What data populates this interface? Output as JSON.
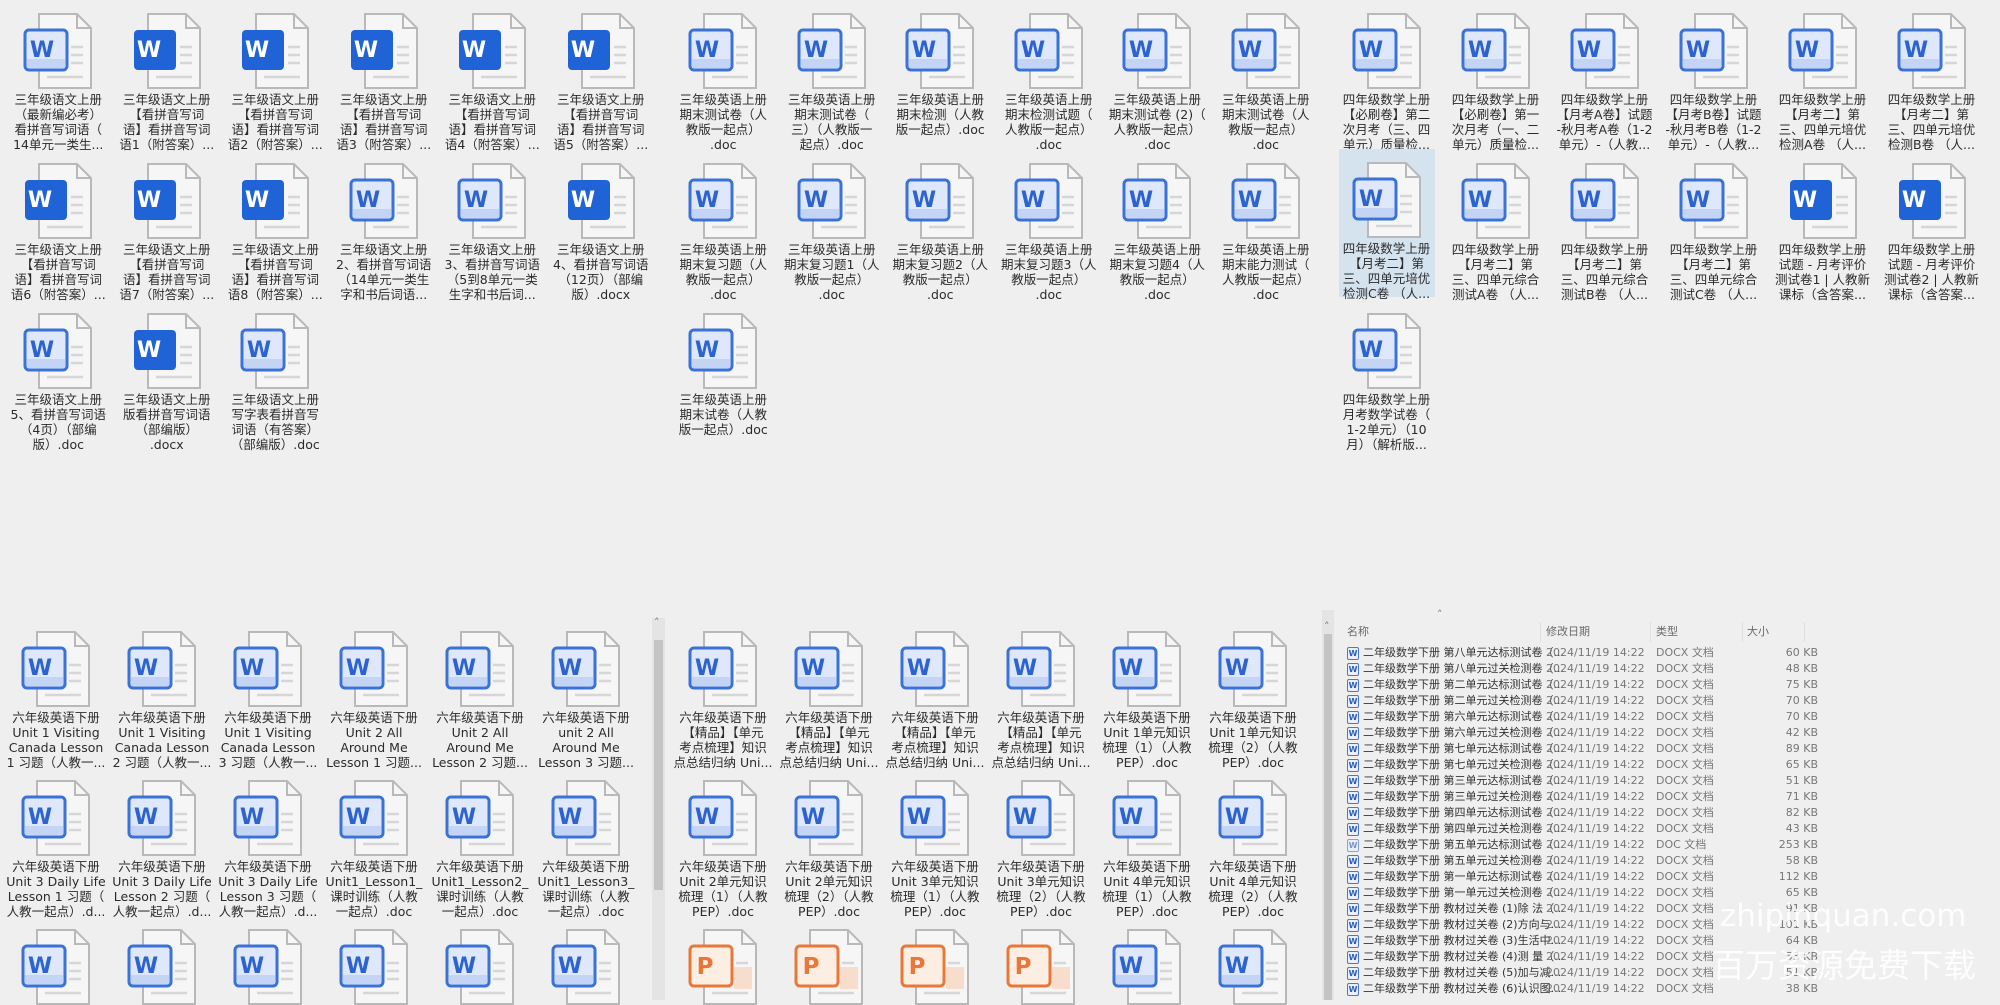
{
  "colors": {
    "word_dark": "#1f63d6",
    "word_light_border": "#3a72d8",
    "word_light_fill": "#dfe8fa",
    "ppt": "#e8783a",
    "selected_bg": "#d5e3ef",
    "background": "#efefef"
  },
  "panels": [
    {
      "name": "grade3-chinese-panel",
      "items": [
        {
          "icon": "word-light",
          "label": "三年级语文上册\n（最新编必考）\n看拼音写词语（\n14单元一类生..."
        },
        {
          "icon": "word-dark",
          "label": "三年级语文上册\n【看拼音写词\n语】看拼音写词\n语1（附答案）..."
        },
        {
          "icon": "word-dark",
          "label": "三年级语文上册\n【看拼音写词\n语】看拼音写词\n语2（附答案）..."
        },
        {
          "icon": "word-dark",
          "label": "三年级语文上册\n【看拼音写词\n语】看拼音写词\n语3（附答案）..."
        },
        {
          "icon": "word-dark",
          "label": "三年级语文上册\n【看拼音写词\n语】看拼音写词\n语4（附答案）..."
        },
        {
          "icon": "word-dark",
          "label": "三年级语文上册\n【看拼音写词\n语】看拼音写词\n语5（附答案）..."
        },
        {
          "icon": "word-dark",
          "label": "三年级语文上册\n【看拼音写词\n语】看拼音写词\n语6（附答案）..."
        },
        {
          "icon": "word-dark",
          "label": "三年级语文上册\n【看拼音写词\n语】看拼音写词\n语7（附答案）..."
        },
        {
          "icon": "word-dark",
          "label": "三年级语文上册\n【看拼音写词\n语】看拼音写词\n语8（附答案）..."
        },
        {
          "icon": "word-light",
          "label": "三年级语文上册\n2、看拼音写词语\n（14单元一类生\n字和书后词语..."
        },
        {
          "icon": "word-light",
          "label": "三年级语文上册\n3、看拼音写词语\n（5到8单元一类\n生字和书后词..."
        },
        {
          "icon": "word-dark",
          "label": "三年级语文上册\n4、看拼音写词语\n（12页）（部编\n版）.docx"
        },
        {
          "icon": "word-light",
          "label": "三年级语文上册\n5、看拼音写词语\n（4页）（部编\n版）.doc"
        },
        {
          "icon": "word-dark",
          "label": "三年级语文上册\n版看拼音写词语\n（部编版）\n.docx"
        },
        {
          "icon": "word-light",
          "label": "三年级语文上册\n写字表看拼音写\n词语（有答案）\n（部编版）.doc"
        }
      ]
    },
    {
      "name": "grade3-english-panel",
      "items": [
        {
          "icon": "word-light",
          "label": "三年级英语上册\n期末测试卷（人\n教版一起点）\n.doc"
        },
        {
          "icon": "word-light",
          "label": "三年级英语上册\n期末测试卷（\n三）（人教版一\n起点）.doc"
        },
        {
          "icon": "word-light",
          "label": "三年级英语上册\n期末检测（人教\n版一起点）.doc"
        },
        {
          "icon": "word-light",
          "label": "三年级英语上册\n期末检测试题（\n人教版一起点）\n.doc"
        },
        {
          "icon": "word-light",
          "label": "三年级英语上册\n期末测试卷 (2)（\n人教版一起点）\n.doc"
        },
        {
          "icon": "word-light",
          "label": "三年级英语上册\n期末测试卷（人\n教版一起点）\n.doc"
        },
        {
          "icon": "word-light",
          "label": "三年级英语上册\n期末复习题（人\n教版一起点）\n.doc"
        },
        {
          "icon": "word-light",
          "label": "三年级英语上册\n期末复习题1（人\n教版一起点）\n.doc"
        },
        {
          "icon": "word-light",
          "label": "三年级英语上册\n期末复习题2（人\n教版一起点）\n.doc"
        },
        {
          "icon": "word-light",
          "label": "三年级英语上册\n期末复习题3（人\n教版一起点）\n.doc"
        },
        {
          "icon": "word-light",
          "label": "三年级英语上册\n期末复习题4（人\n教版一起点）\n.doc"
        },
        {
          "icon": "word-light",
          "label": "三年级英语上册\n期末能力测试（\n人教版一起点）\n.doc"
        },
        {
          "icon": "word-light",
          "label": "三年级英语上册\n期末试卷（人教\n版一起点）.doc"
        }
      ]
    },
    {
      "name": "grade4-math-panel",
      "items": [
        {
          "icon": "word-light",
          "label": "四年级数学上册\n【必刷卷】第二\n次月考（三、四\n单元）质量检..."
        },
        {
          "icon": "word-light",
          "label": "四年级数学上册\n【必刷卷】第一\n次月考（一、二\n单元）质量检..."
        },
        {
          "icon": "word-light",
          "label": "四年级数学上册\n【月考A卷】试题\n-秋月考A卷（1-2\n单元）-（人教..."
        },
        {
          "icon": "word-light",
          "label": "四年级数学上册\n【月考B卷】试题\n-秋月考B卷（1-2\n单元）-（人教..."
        },
        {
          "icon": "word-light",
          "label": "四年级数学上册\n【月考二】第\n三、四单元培优\n检测A卷 （人..."
        },
        {
          "icon": "word-light",
          "label": "四年级数学上册\n【月考二】第\n三、四单元培优\n检测B卷 （人..."
        },
        {
          "icon": "word-light",
          "selected": true,
          "label": "四年级数学上册\n【月考二】第\n三、四单元培优\n检测C卷 （人..."
        },
        {
          "icon": "word-light",
          "label": "四年级数学上册\n【月考二】第\n三、四单元综合\n测试A卷 （人..."
        },
        {
          "icon": "word-light",
          "label": "四年级数学上册\n【月考二】第\n三、四单元综合\n测试B卷 （人..."
        },
        {
          "icon": "word-light",
          "label": "四年级数学上册\n【月考二】第\n三、四单元综合\n测试C卷 （人..."
        },
        {
          "icon": "word-dark",
          "label": "四年级数学上册\n试题 - 月考评价\n测试卷1 | 人教新\n课标（含答案..."
        },
        {
          "icon": "word-dark",
          "label": "四年级数学上册\n试题 - 月考评价\n测试卷2 | 人教新\n课标（含答案..."
        },
        {
          "icon": "word-light",
          "label": "四年级数学上册\n月考数学试卷（\n1-2单元）（10\n月）（解析版..."
        }
      ]
    },
    {
      "name": "grade6-english-panel-a",
      "items": [
        {
          "icon": "word-light",
          "label": "六年级英语下册\nUnit 1 Visiting\nCanada Lesson\n1 习题（人教一..."
        },
        {
          "icon": "word-light",
          "label": "六年级英语下册\nUnit 1 Visiting\nCanada Lesson\n2 习题（人教一..."
        },
        {
          "icon": "word-light",
          "label": "六年级英语下册\nUnit 1 Visiting\nCanada Lesson\n3 习题（人教一..."
        },
        {
          "icon": "word-light",
          "label": "六年级英语下册\nUnit 2 All\nAround Me\nLesson 1 习题..."
        },
        {
          "icon": "word-light",
          "label": "六年级英语下册\nUnit 2 All\nAround Me\nLesson 2 习题..."
        },
        {
          "icon": "word-light",
          "label": "六年级英语下册\nunit 2 All\nAround Me\nLesson 3 习题..."
        },
        {
          "icon": "word-light",
          "label": "六年级英语下册\nUnit 3 Daily Life\nLesson 1 习题（\n人教一起点）.d..."
        },
        {
          "icon": "word-light",
          "label": "六年级英语下册\nUnit 3 Daily Life\nLesson 2 习题（\n人教一起点）.d..."
        },
        {
          "icon": "word-light",
          "label": "六年级英语下册\nUnit 3 Daily Life\nLesson 3 习题（\n人教一起点）.d..."
        },
        {
          "icon": "word-light",
          "label": "六年级英语下册\nUnit1_Lesson1_\n课时训练（人教\n一起点）.doc"
        },
        {
          "icon": "word-light",
          "label": "六年级英语下册\nUnit1_Lesson2_\n课时训练（人教\n一起点）.doc"
        },
        {
          "icon": "word-light",
          "label": "六年级英语下册\nUnit1_Lesson3_\n课时训练（人教\n一起点）.doc"
        },
        {
          "icon": "word-light",
          "label": ""
        },
        {
          "icon": "word-light",
          "label": ""
        },
        {
          "icon": "word-light",
          "label": ""
        },
        {
          "icon": "word-light",
          "label": ""
        },
        {
          "icon": "word-light",
          "label": ""
        },
        {
          "icon": "word-light",
          "label": ""
        }
      ]
    },
    {
      "name": "grade6-english-panel-b",
      "items": [
        {
          "icon": "word-light",
          "label": "六年级英语下册\n【精品】【单元\n考点梳理】知识\n点总结归纳 Uni..."
        },
        {
          "icon": "word-light",
          "label": "六年级英语下册\n【精品】【单元\n考点梳理】知识\n点总结归纳 Uni..."
        },
        {
          "icon": "word-light",
          "label": "六年级英语下册\n【精品】【单元\n考点梳理】知识\n点总结归纳 Uni..."
        },
        {
          "icon": "word-light",
          "label": "六年级英语下册\n【精品】【单元\n考点梳理】知识\n点总结归纳 Uni..."
        },
        {
          "icon": "word-light",
          "label": "六年级英语下册\nUnit 1单元知识\n梳理（1）（人教\nPEP）.doc"
        },
        {
          "icon": "word-light",
          "label": "六年级英语下册\nUnit 1单元知识\n梳理（2）（人教\nPEP）.doc"
        },
        {
          "icon": "word-light",
          "label": "六年级英语下册\nUnit 2单元知识\n梳理（1）（人教\nPEP）.doc"
        },
        {
          "icon": "word-light",
          "label": "六年级英语下册\nUnit 2单元知识\n梳理（2）（人教\nPEP）.doc"
        },
        {
          "icon": "word-light",
          "label": "六年级英语下册\nUnit 3单元知识\n梳理（1）（人教\nPEP）.doc"
        },
        {
          "icon": "word-light",
          "label": "六年级英语下册\nUnit 3单元知识\n梳理（2）（人教\nPEP）.doc"
        },
        {
          "icon": "word-light",
          "label": "六年级英语下册\nUnit 4单元知识\n梳理（1）（人教\nPEP）.doc"
        },
        {
          "icon": "word-light",
          "label": "六年级英语下册\nUnit 4单元知识\n梳理（2）（人教\nPEP）.doc"
        },
        {
          "icon": "ppt",
          "label": ""
        },
        {
          "icon": "ppt",
          "label": ""
        },
        {
          "icon": "ppt",
          "label": ""
        },
        {
          "icon": "ppt",
          "label": ""
        },
        {
          "icon": "word-light",
          "label": ""
        },
        {
          "icon": "word-light",
          "label": ""
        }
      ]
    }
  ],
  "list": {
    "headers": {
      "name": "名称",
      "date": "修改日期",
      "type": "类型",
      "size": "大小"
    },
    "rows": [
      {
        "name": "二年级数学下册  第八单元达标测试卷（...",
        "date": "2024/11/19 14:22",
        "type": "DOCX 文档",
        "size": "60 KB"
      },
      {
        "name": "二年级数学下册  第八单元过关检测卷（...",
        "date": "2024/11/19 14:22",
        "type": "DOCX 文档",
        "size": "48 KB"
      },
      {
        "name": "二年级数学下册  第二单元达标测试卷（...",
        "date": "2024/11/19 14:22",
        "type": "DOCX 文档",
        "size": "75 KB"
      },
      {
        "name": "二年级数学下册  第二单元过关检测卷（...",
        "date": "2024/11/19 14:22",
        "type": "DOCX 文档",
        "size": "70 KB"
      },
      {
        "name": "二年级数学下册  第六单元达标测试卷（...",
        "date": "2024/11/19 14:22",
        "type": "DOCX 文档",
        "size": "70 KB"
      },
      {
        "name": "二年级数学下册  第六单元过关检测卷（...",
        "date": "2024/11/19 14:22",
        "type": "DOCX 文档",
        "size": "42 KB"
      },
      {
        "name": "二年级数学下册  第七单元达标测试卷（...",
        "date": "2024/11/19 14:22",
        "type": "DOCX 文档",
        "size": "89 KB"
      },
      {
        "name": "二年级数学下册  第七单元过关检测卷（...",
        "date": "2024/11/19 14:22",
        "type": "DOCX 文档",
        "size": "65 KB"
      },
      {
        "name": "二年级数学下册  第三单元达标测试卷（...",
        "date": "2024/11/19 14:22",
        "type": "DOCX 文档",
        "size": "51 KB"
      },
      {
        "name": "二年级数学下册  第三单元过关检测卷（...",
        "date": "2024/11/19 14:22",
        "type": "DOCX 文档",
        "size": "71 KB"
      },
      {
        "name": "二年级数学下册  第四单元达标测试卷（...",
        "date": "2024/11/19 14:22",
        "type": "DOCX 文档",
        "size": "82 KB"
      },
      {
        "name": "二年级数学下册  第四单元过关检测卷（...",
        "date": "2024/11/19 14:22",
        "type": "DOCX 文档",
        "size": "43 KB"
      },
      {
        "name": "二年级数学下册  第五单元达标测试卷（...",
        "date": "2024/11/19 14:22",
        "type": "DOC 文档",
        "size": "253 KB",
        "doc": true
      },
      {
        "name": "二年级数学下册  第五单元过关检测卷（...",
        "date": "2024/11/19 14:22",
        "type": "DOCX 文档",
        "size": "58 KB"
      },
      {
        "name": "二年级数学下册  第一单元达标测试卷（...",
        "date": "2024/11/19 14:22",
        "type": "DOCX 文档",
        "size": "112 KB"
      },
      {
        "name": "二年级数学下册  第一单元过关检测卷（...",
        "date": "2024/11/19 14:22",
        "type": "DOCX 文档",
        "size": "65 KB"
      },
      {
        "name": "二年级数学下册  教材过关卷 (1)除 法（...",
        "date": "2024/11/19 14:22",
        "type": "DOCX 文档",
        "size": "91 KB"
      },
      {
        "name": "二年级数学下册  教材过关卷 (2)方向与...",
        "date": "2024/11/19 14:22",
        "type": "DOCX 文档",
        "size": "101 KB"
      },
      {
        "name": "二年级数学下册  教材过关卷 (3)生活中...",
        "date": "2024/11/19 14:22",
        "type": "DOCX 文档",
        "size": "64 KB"
      },
      {
        "name": "二年级数学下册  教材过关卷 (4)测 量（...",
        "date": "2024/11/19 14:22",
        "type": "DOCX 文档",
        "size": "53 KB"
      },
      {
        "name": "二年级数学下册  教材过关卷 (5)加与减...",
        "date": "2024/11/19 14:22",
        "type": "DOCX 文档",
        "size": "51 KB"
      },
      {
        "name": "二年级数学下册  教材过关卷 (6)认识图...",
        "date": "2024/11/19 14:22",
        "type": "DOCX 文档",
        "size": "38 KB"
      }
    ]
  },
  "watermark": {
    "line1": "zhipinquan.com",
    "line2": "百万资源免费下载"
  }
}
